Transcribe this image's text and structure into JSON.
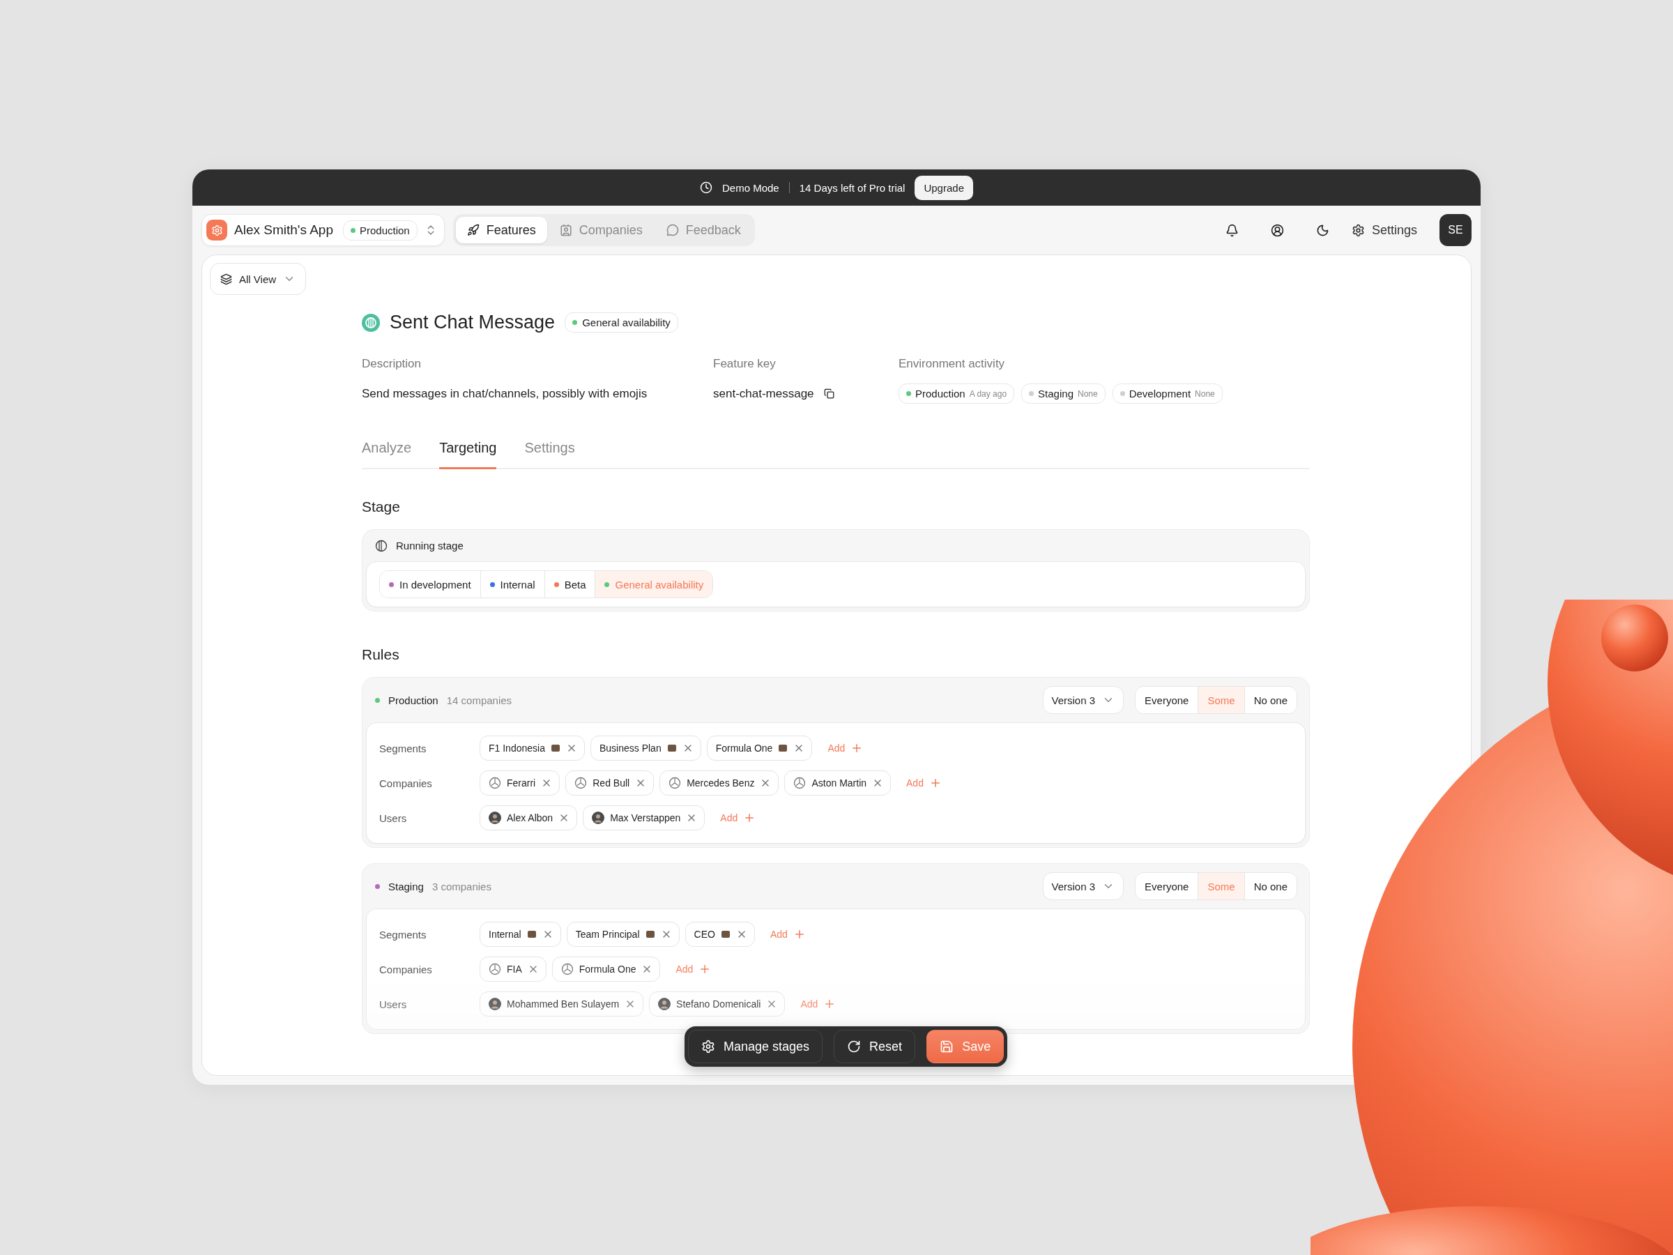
{
  "banner": {
    "mode": "Demo Mode",
    "trial": "14 Days left of Pro trial",
    "upgrade": "Upgrade"
  },
  "app": {
    "name": "Alex Smith's App",
    "environment": "Production"
  },
  "nav_tabs": [
    {
      "label": "Features",
      "selected": true
    },
    {
      "label": "Companies",
      "selected": false
    },
    {
      "label": "Feedback",
      "selected": false
    }
  ],
  "settings": "Settings",
  "avatar": "SE",
  "view": "All View",
  "feature": {
    "title": "Sent Chat Message",
    "stage_badge": "General availability",
    "description_label": "Description",
    "description": "Send messages in chat/channels, possibly with emojis",
    "key_label": "Feature key",
    "key": "sent-chat-message",
    "activity_label": "Environment activity",
    "activity": [
      {
        "name": "Production",
        "when": "A day ago",
        "color": "#5cc97d"
      },
      {
        "name": "Staging",
        "when": "None",
        "color": "#cfcfcf"
      },
      {
        "name": "Development",
        "when": "None",
        "color": "#cfcfcf"
      }
    ]
  },
  "tabs": [
    {
      "label": "Analyze",
      "selected": false
    },
    {
      "label": "Targeting",
      "selected": true
    },
    {
      "label": "Settings",
      "selected": false
    }
  ],
  "stage": {
    "heading": "Stage",
    "card_title": "Running stage",
    "options": [
      {
        "label": "In development",
        "color": "#b86ab8",
        "selected": false
      },
      {
        "label": "Internal",
        "color": "#3f6fe6",
        "selected": false
      },
      {
        "label": "Beta",
        "color": "#f07a55",
        "selected": false
      },
      {
        "label": "General availability",
        "color": "#5cc97d",
        "selected": true
      }
    ]
  },
  "rules": {
    "heading": "Rules",
    "environments": [
      {
        "name": "Production",
        "count": "14 companies",
        "color": "#5cc97d",
        "version": "Version 3",
        "audience": [
          {
            "label": "Everyone",
            "selected": false
          },
          {
            "label": "Some",
            "selected": true
          },
          {
            "label": "No one",
            "selected": false
          }
        ],
        "rows": [
          {
            "label": "Segments",
            "add": "Add",
            "chips": [
              {
                "kind": "segment",
                "label": "F1 Indonesia"
              },
              {
                "kind": "segment",
                "label": "Business Plan"
              },
              {
                "kind": "segment",
                "label": "Formula One"
              }
            ]
          },
          {
            "label": "Companies",
            "add": "Add",
            "chips": [
              {
                "kind": "company",
                "label": "Ferarri"
              },
              {
                "kind": "company",
                "label": "Red Bull"
              },
              {
                "kind": "company",
                "label": "Mercedes Benz"
              },
              {
                "kind": "company",
                "label": "Aston Martin"
              }
            ]
          },
          {
            "label": "Users",
            "add": "Add",
            "chips": [
              {
                "kind": "user",
                "label": "Alex Albon"
              },
              {
                "kind": "user",
                "label": "Max Verstappen"
              }
            ]
          }
        ]
      },
      {
        "name": "Staging",
        "count": "3 companies",
        "color": "#b86ab8",
        "version": "Version 3",
        "audience": [
          {
            "label": "Everyone",
            "selected": false
          },
          {
            "label": "Some",
            "selected": true
          },
          {
            "label": "No one",
            "selected": false
          }
        ],
        "rows": [
          {
            "label": "Segments",
            "add": "Add",
            "chips": [
              {
                "kind": "segment",
                "label": "Internal"
              },
              {
                "kind": "segment",
                "label": "Team Principal"
              },
              {
                "kind": "segment",
                "label": "CEO"
              }
            ]
          },
          {
            "label": "Companies",
            "add": "Add",
            "chips": [
              {
                "kind": "company",
                "label": "FIA"
              },
              {
                "kind": "company",
                "label": "Formula One"
              }
            ]
          },
          {
            "label": "Users",
            "add": "Add",
            "chips": [
              {
                "kind": "user",
                "label": "Mohammed Ben Sulayem"
              },
              {
                "kind": "user",
                "label": "Stefano Domenicali"
              }
            ]
          }
        ]
      }
    ]
  },
  "actions": [
    {
      "kind": "settings",
      "label": "Manage stages"
    },
    {
      "kind": "reset",
      "label": "Reset"
    },
    {
      "kind": "save",
      "label": "Save"
    }
  ]
}
